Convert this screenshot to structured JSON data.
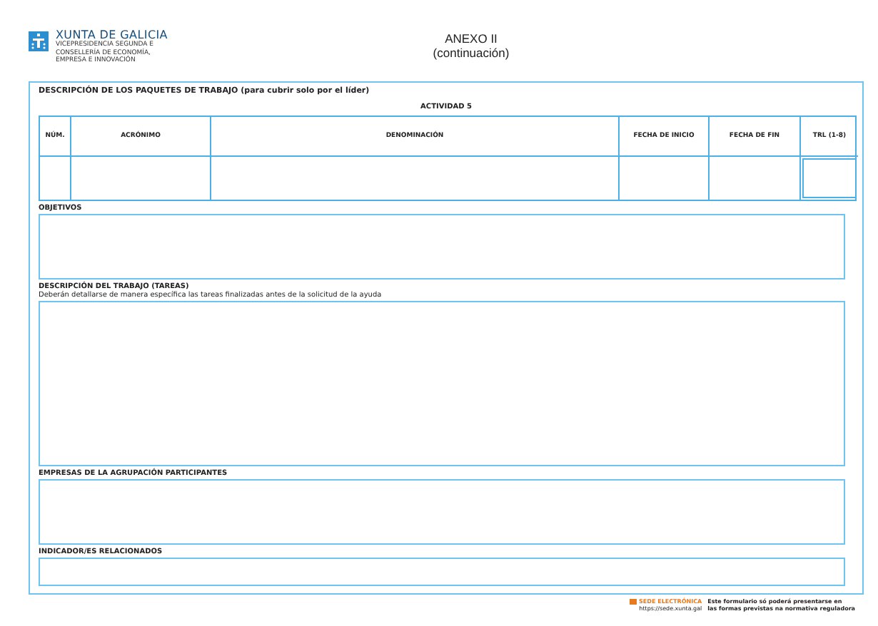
{
  "header": {
    "org_name": "XUNTA DE GALICIA",
    "org_departments": [
      "VICEPRESIDENCIA SEGUNDA E",
      "CONSELLERÍA DE ECONOMÍA,",
      "EMPRESA E INNOVACIÓN"
    ],
    "annex_title": "ANEXO II",
    "annex_subtitle": "(continuación)"
  },
  "form": {
    "title": "DESCRIPCIÓN DE LOS PAQUETES DE TRABAJO (para cubrir solo por el líder)",
    "activity": "ACTIVIDAD 5",
    "table": {
      "columns": [
        "NÚM.",
        "ACRÓNIMO",
        "DENOMINACIÓN",
        "FECHA DE INICIO",
        "FECHA DE FIN",
        "TRL (1-8)"
      ]
    },
    "sections": [
      {
        "label": "OBJETIVOS"
      },
      {
        "label": "DESCRIPCIÓN DEL TRABAJO (TAREAS)",
        "note": "Deberán detallarse de manera específica las tareas finalizadas antes de la solicitud de la ayuda"
      },
      {
        "label": "EMPRESAS DE LA AGRUPACIÓN PARTICIPANTES"
      },
      {
        "label": "INDICADOR/ES RELACIONADOS"
      }
    ]
  },
  "footer": {
    "badge": "SEDE ELECTRÓNICA",
    "url": "https://sede.xunta.gal",
    "notice": [
      "Este formulario só poderá presentarse en",
      "las formas previstas na normativa reguladora"
    ]
  }
}
